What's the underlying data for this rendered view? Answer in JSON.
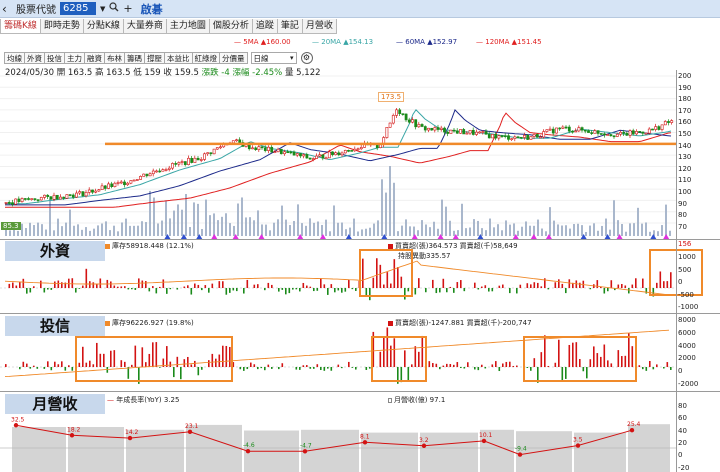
{
  "titlebar": {
    "back_glyph": "‹",
    "label": "股票代號",
    "code": "6285",
    "name": "啟碁"
  },
  "tabs": [
    "籌碼K線",
    "即時走勢",
    "分點K線",
    "大量券商",
    "主力地圖",
    "個股分析",
    "追蹤",
    "筆記",
    "月營收"
  ],
  "ma_legend": {
    "ma5": "5MA ▲160.00",
    "ma20": "20MA ▲154.13",
    "ma60": "60MA ▲152.97",
    "ma120": "120MA ▲151.45"
  },
  "toolbar": {
    "buttons": [
      "均線",
      "外資",
      "投信",
      "主力",
      "融資",
      "布林",
      "籌碼",
      "撐壓",
      "本益比",
      "紅綠燈",
      "分價量"
    ],
    "period": "日線"
  },
  "info": {
    "date": "2024/05/30",
    "open": "開 163.5",
    "high": "高 163.5",
    "low": "低 159",
    "close": "收 159.5",
    "change": "漲跌 -4",
    "pct": "漲幅 -2.45%",
    "volume": "量 5,122"
  },
  "price": {
    "peak_label": "173.5",
    "low_label": "85.3",
    "axis": [
      "200",
      "190",
      "180",
      "170",
      "160",
      "150",
      "140",
      "130",
      "120",
      "110",
      "100",
      "90",
      "80",
      "70"
    ]
  },
  "foreign": {
    "label": "外資",
    "holding": "庫存58918.448 (12.1%)",
    "buysell": "買賣超(張)364.573 買賣超(千)58,649",
    "hold_change": "持股異動335.57",
    "axis": [
      "1000",
      "500",
      "0",
      "-500",
      "-1000"
    ],
    "top_value": "156"
  },
  "trust": {
    "label": "投信",
    "holding": "庫存96226.927 (19.8%)",
    "buysell": "買賣超(張)-1247.881 買賣超(千)-200,747",
    "axis": [
      "8000",
      "6000",
      "4000",
      "2000",
      "0",
      "-2000"
    ]
  },
  "revenue": {
    "label": "月營收",
    "yoy_legend": "年成長率(YoY) 3.25",
    "rev_legend": "月營收(億) 97.1",
    "axis": [
      "80",
      "60",
      "40",
      "20",
      "0",
      "-20"
    ],
    "yoy_labels": [
      "32.5",
      "18.2",
      "14.2",
      "23.1",
      "-4.6",
      "-4.7",
      "8.1",
      "3.2",
      "10.1",
      "-9.4",
      "3.5",
      "25.4"
    ]
  },
  "colors": {
    "up": "#d31313",
    "down": "#1a8a1a",
    "ma5": "#e02020",
    "ma20": "#3aa6a6",
    "ma60": "#1d2a8a",
    "ma120": "#e02020",
    "support_line": "#f08a2a",
    "label_bg": "#c8d8ec"
  }
}
